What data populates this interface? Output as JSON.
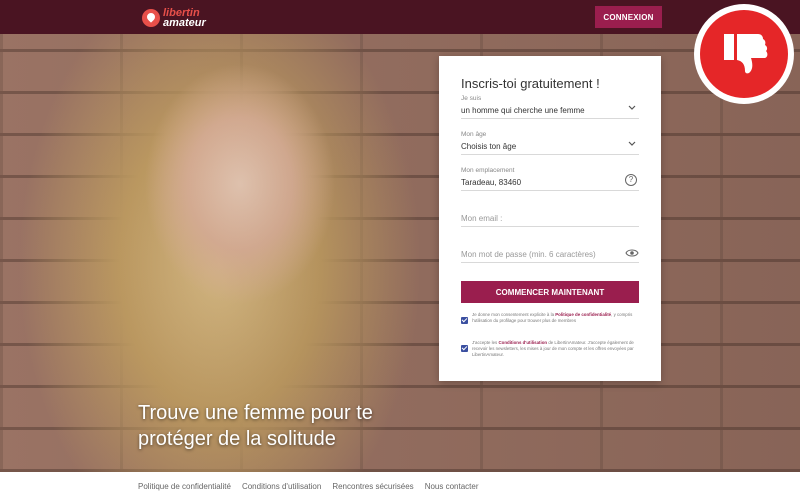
{
  "header": {
    "logo_line1": "libertin",
    "logo_line2": "amateur",
    "login_button": "CONNEXION"
  },
  "hero": {
    "title": "Trouve une femme pour te protéger de la solitude"
  },
  "badge": {
    "icon": "thumbs-down-icon",
    "color": "#e52628"
  },
  "form": {
    "title": "Inscris-toi gratuitement !",
    "je_suis": {
      "label": "Je suis",
      "value": "un homme qui cherche une femme"
    },
    "age": {
      "label": "Mon âge",
      "value": "Choisis ton âge"
    },
    "location": {
      "label": "Mon emplacement",
      "value": "Taradeau, 83460"
    },
    "email": {
      "placeholder": "Mon email :"
    },
    "password": {
      "placeholder": "Mon mot de passe (min. 6 caractères)"
    },
    "submit_label": "COMMENCER MAINTENANT",
    "consent1": {
      "before": "Je donne mon consentement explicite à la",
      "link": "Politique de confidentialité",
      "after": ", y compris l'utilisation du profilage pour trouver plus de membres"
    },
    "consent2": {
      "before": "J'accepte les",
      "link": "Conditions d'utilisation",
      "after": "de LibertinAmateur. J'accepte également de recevoir les newsletters, les mises à jour de mon compte et les offres envoyées par LibertinAmateur."
    }
  },
  "footer": {
    "links": [
      "Politique de confidentialité",
      "Conditions d'utilisation",
      "Rencontres sécurisées",
      "Nous contacter"
    ]
  },
  "colors": {
    "topbar": "#4a1422",
    "accent": "#9a1e4e",
    "badge_red": "#e52628"
  }
}
